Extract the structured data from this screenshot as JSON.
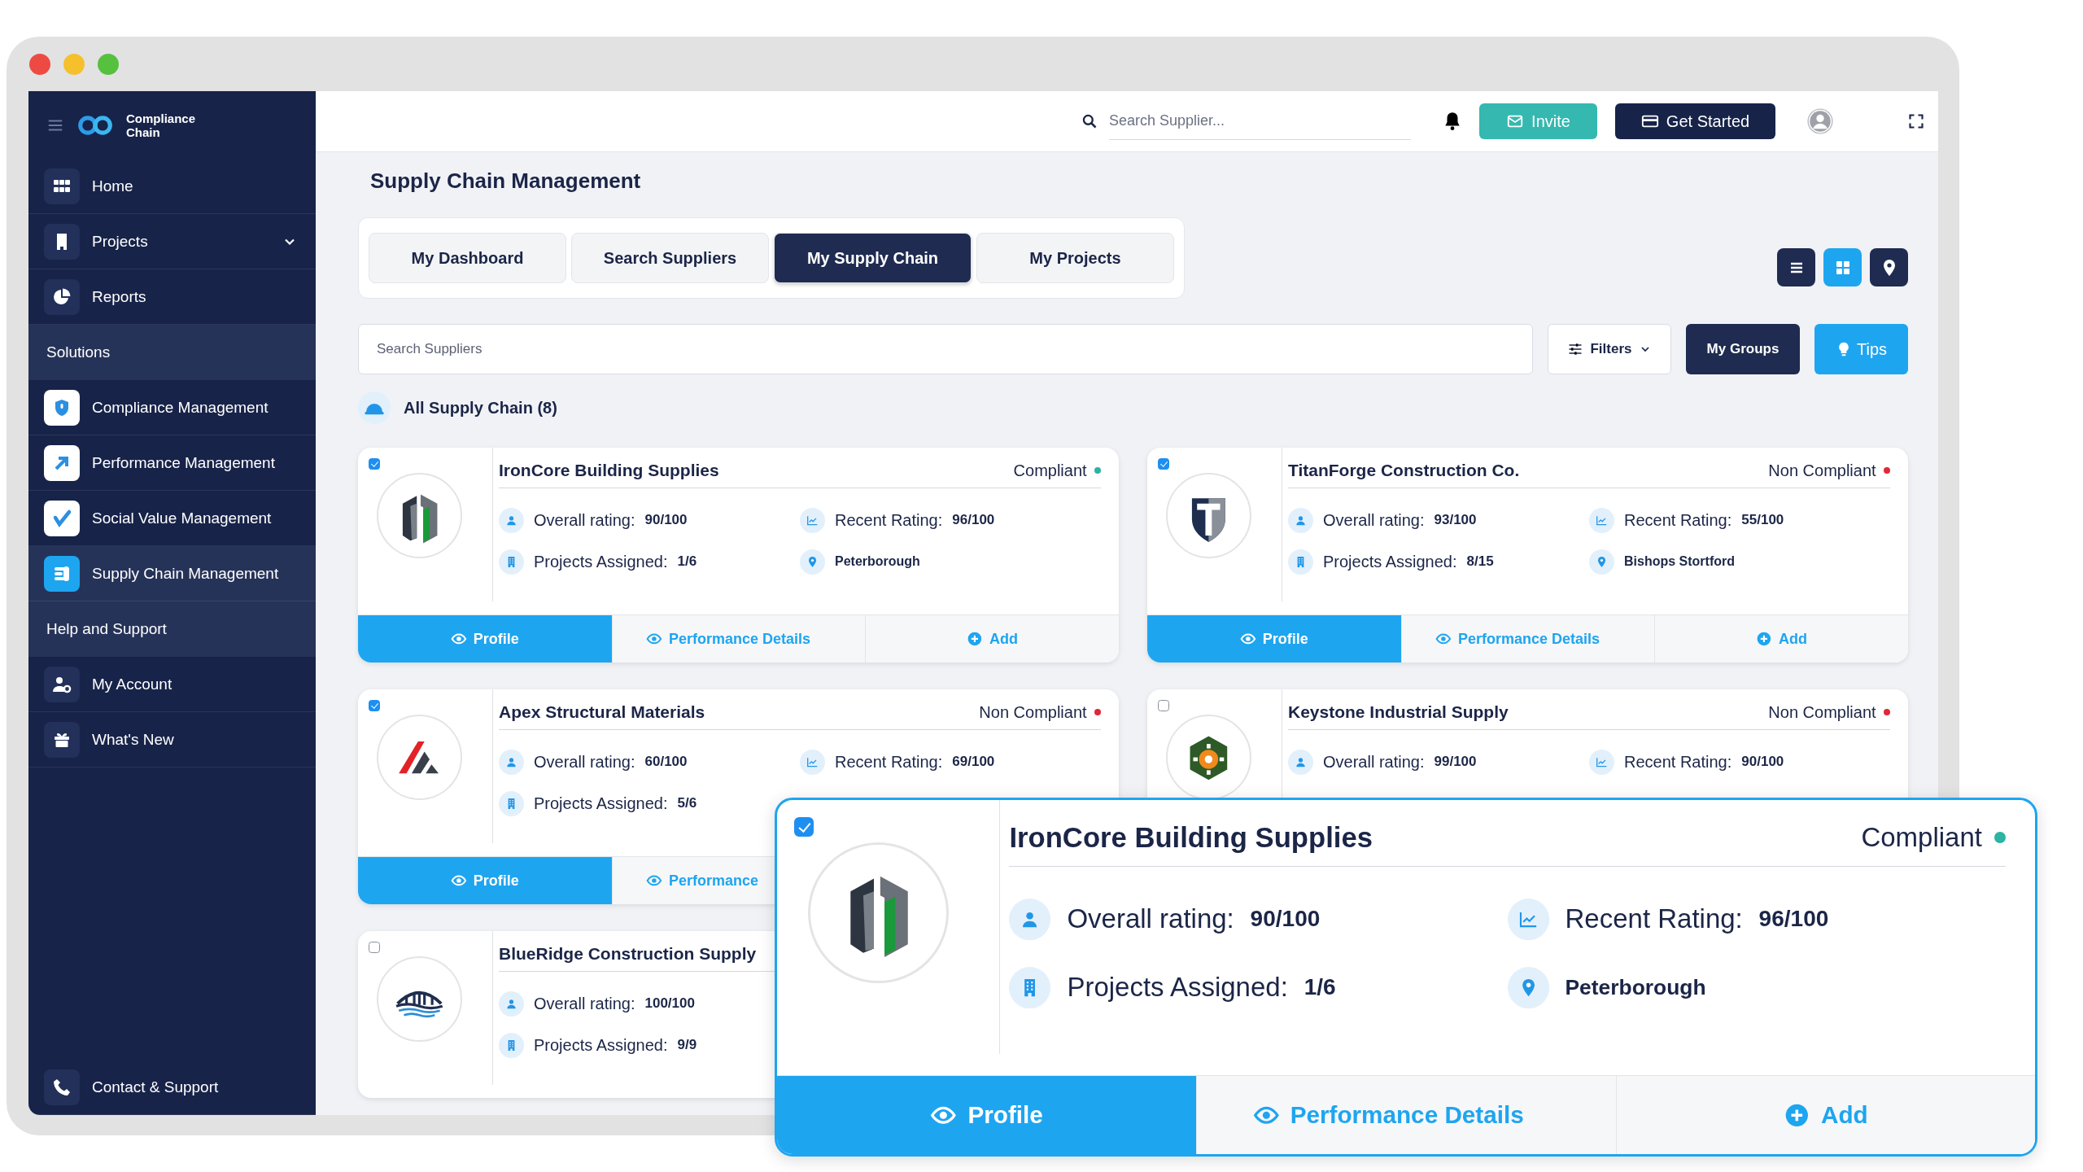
{
  "sidebar": {
    "brand": "Compliance Chain",
    "nav": [
      {
        "label": "Home",
        "selected": false,
        "submenu": false
      },
      {
        "label": "Projects",
        "selected": false,
        "submenu": true
      },
      {
        "label": "Reports",
        "selected": false,
        "submenu": false
      }
    ],
    "sections": [
      {
        "heading": "Solutions",
        "items": [
          {
            "label": "Compliance Management",
            "selected": false
          },
          {
            "label": "Performance Management",
            "selected": false
          },
          {
            "label": "Social Value Management",
            "selected": false
          },
          {
            "label": "Supply Chain Management",
            "selected": true
          }
        ]
      },
      {
        "heading": "Help and Support",
        "items": [
          {
            "label": "My Account",
            "selected": false
          },
          {
            "label": "What's New",
            "selected": false
          }
        ]
      }
    ],
    "footer_items": [
      {
        "label": "Contact & Support",
        "selected": false
      }
    ]
  },
  "topbar": {
    "search": {
      "placeholder": "Search Supplier..."
    },
    "buttons": [
      {
        "kind": "invite",
        "label": "Invite"
      },
      {
        "kind": "start",
        "label": "Get Started"
      }
    ]
  },
  "page_title": "Supply Chain Management",
  "tabs": [
    {
      "label": "My Dashboard",
      "selected": false
    },
    {
      "label": "Search Suppliers",
      "selected": false
    },
    {
      "label": "My Supply Chain",
      "selected": true
    },
    {
      "label": "My Projects",
      "selected": false
    }
  ],
  "view_buttons": [
    {
      "selected": false
    },
    {
      "selected": true
    },
    {
      "selected": false
    }
  ],
  "search": {
    "placeholder": "Search Suppliers"
  },
  "filters": "Filters",
  "groups": "My Groups",
  "tips": "Tips",
  "list_heading": "All Supply Chain (8)",
  "cards": [
    {
      "name": "IronCore Building Supplies",
      "status": "Compliant",
      "color": "#2bb3a3",
      "selected": true,
      "fields": [
        {
          "kind": "overall",
          "label": "Overall rating:",
          "value": "90/100"
        },
        {
          "kind": "recent",
          "label": "Recent Rating:",
          "value": "96/100"
        },
        {
          "kind": "projects",
          "label": "Projects Assigned:",
          "value": "1/6"
        },
        {
          "kind": "location",
          "value": "Peterborough"
        }
      ],
      "actions": [
        {
          "kind": "profile",
          "label": "Profile"
        },
        {
          "kind": "details",
          "label": "Performance Details"
        },
        {
          "kind": "add",
          "label": "Add"
        }
      ]
    },
    {
      "name": "TitanForge Construction Co.",
      "status": "Non Compliant",
      "color": "#e0283a",
      "selected": true,
      "fields": [
        {
          "kind": "overall",
          "label": "Overall rating:",
          "value": "93/100"
        },
        {
          "kind": "recent",
          "label": "Recent Rating:",
          "value": "55/100"
        },
        {
          "kind": "projects",
          "label": "Projects Assigned:",
          "value": "8/15"
        },
        {
          "kind": "location",
          "value": "Bishops Stortford"
        }
      ],
      "actions": [
        {
          "kind": "profile",
          "label": "Profile"
        },
        {
          "kind": "details",
          "label": "Performance Details"
        },
        {
          "kind": "add",
          "label": "Add"
        }
      ]
    },
    {
      "name": "Apex Structural Materials",
      "status": "Non Compliant",
      "color": "#e0283a",
      "selected": true,
      "fields": [
        {
          "kind": "overall",
          "label": "Overall rating:",
          "value": "60/100"
        },
        {
          "kind": "recent",
          "label": "Recent Rating:",
          "value": "69/100"
        },
        {
          "kind": "projects",
          "label": "Projects Assigned:",
          "value": "5/6"
        }
      ],
      "actions": [
        {
          "kind": "profile",
          "label": "Profile"
        },
        {
          "kind": "details",
          "label": "Performance"
        }
      ]
    },
    {
      "name": "Keystone Industrial Supply",
      "status": "Non Compliant",
      "color": "#e0283a",
      "selected": false,
      "fields": [
        {
          "kind": "overall",
          "label": "Overall rating:",
          "value": "99/100"
        },
        {
          "kind": "recent",
          "label": "Recent Rating:",
          "value": "90/100"
        }
      ]
    },
    {
      "name": "BlueRidge Construction Supply",
      "selected": false,
      "fields": [
        {
          "kind": "overall",
          "label": "Overall rating:",
          "value": "100/100"
        },
        {
          "kind": "projects",
          "label": "Projects Assigned:",
          "value": "9/9"
        }
      ]
    }
  ],
  "callout": {
    "name": "IronCore Building Supplies",
    "status": "Compliant",
    "color": "#2bb3a3",
    "selected": true,
    "fields": [
      {
        "kind": "overall",
        "label": "Overall rating:",
        "value": "90/100"
      },
      {
        "kind": "recent",
        "label": "Recent Rating:",
        "value": "96/100"
      },
      {
        "kind": "projects",
        "label": "Projects Assigned:",
        "value": "1/6"
      },
      {
        "kind": "location",
        "value": "Peterborough"
      }
    ],
    "actions": [
      {
        "kind": "profile",
        "label": "Profile"
      },
      {
        "kind": "details",
        "label": "Performance Details"
      },
      {
        "kind": "add",
        "label": "Add"
      }
    ]
  }
}
